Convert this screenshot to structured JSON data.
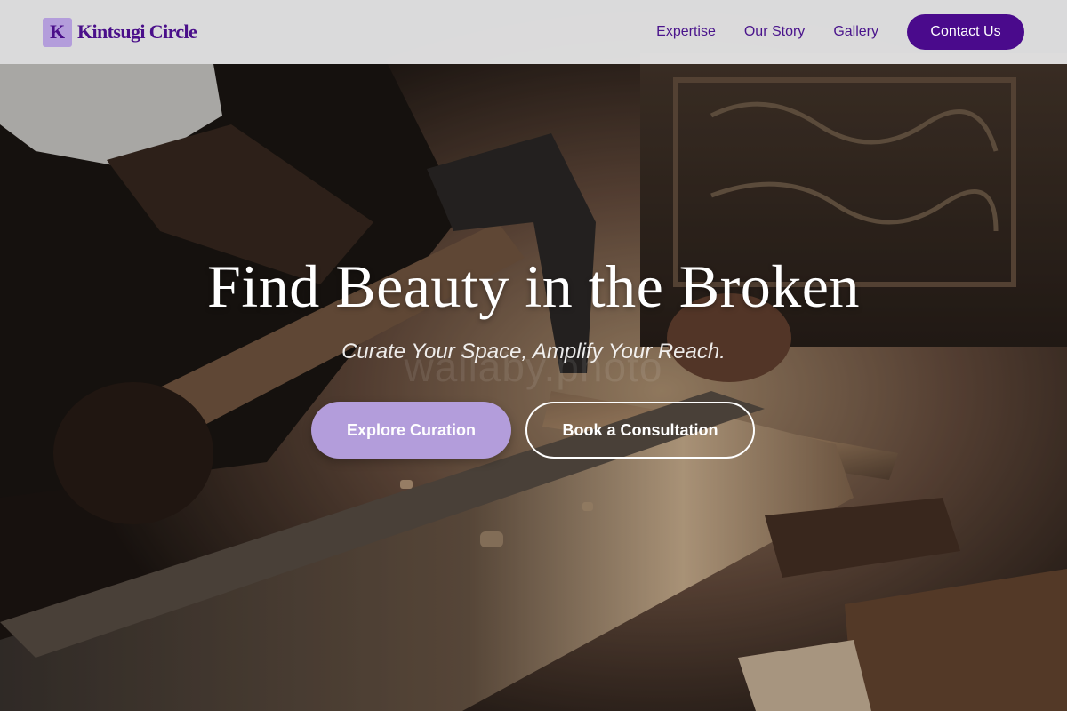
{
  "brand": {
    "mark": "K",
    "name": "Kintsugi Circle"
  },
  "nav": {
    "links": [
      "Expertise",
      "Our Story",
      "Gallery"
    ],
    "cta_label": "Contact Us"
  },
  "hero": {
    "title": "Find Beauty in the Broken",
    "subtitle": "Curate Your Space, Amplify Your Reach.",
    "watermark": "wallaby.photo",
    "primary_button": "Explore Curation",
    "secondary_button": "Book a Consultation",
    "background_image": "woodworker-chiseling-carved-wood-photo"
  },
  "colors": {
    "brand_purple": "#4a0a8c",
    "accent_lavender": "#b39ddb",
    "navbar_bg": "#e9e9eb",
    "text_white": "#ffffff"
  }
}
